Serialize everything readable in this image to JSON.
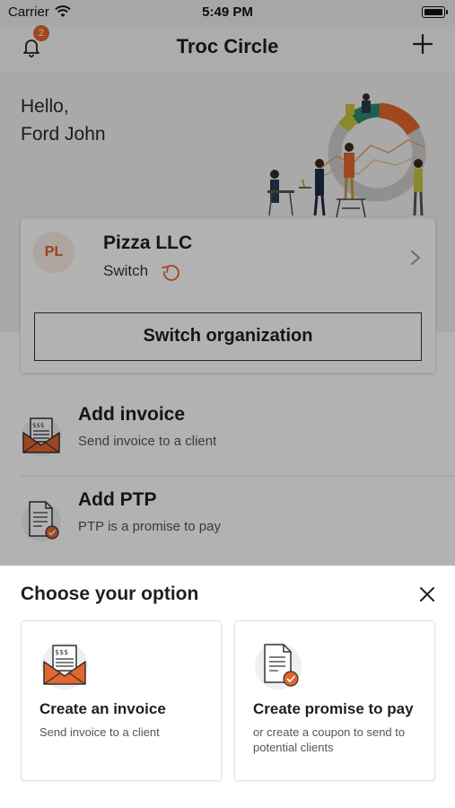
{
  "status_bar": {
    "carrier": "Carrier",
    "time": "5:49 PM"
  },
  "nav": {
    "title": "Troc Circle",
    "notification_count": "2"
  },
  "greeting": {
    "line1": "Hello,",
    "line2": "Ford John"
  },
  "organization": {
    "initials": "PL",
    "name": "Pizza LLC",
    "switch_label": "Switch",
    "switch_button": "Switch organization"
  },
  "actions": [
    {
      "title": "Add invoice",
      "subtitle": "Send invoice to a client",
      "icon": "invoice-envelope-icon"
    },
    {
      "title": "Add PTP",
      "subtitle": "PTP is a promise to pay",
      "icon": "promise-document-icon"
    }
  ],
  "sheet": {
    "title": "Choose your option",
    "options": [
      {
        "title": "Create an invoice",
        "description": "Send invoice to a client",
        "icon": "invoice-envelope-icon"
      },
      {
        "title": "Create promise to pay",
        "description": "or create a coupon to send to potential clients",
        "icon": "promise-document-icon"
      }
    ]
  },
  "colors": {
    "accent": "#e2662e",
    "text": "#1f1f1f",
    "overlay": "rgba(0,0,0,0.30)"
  }
}
